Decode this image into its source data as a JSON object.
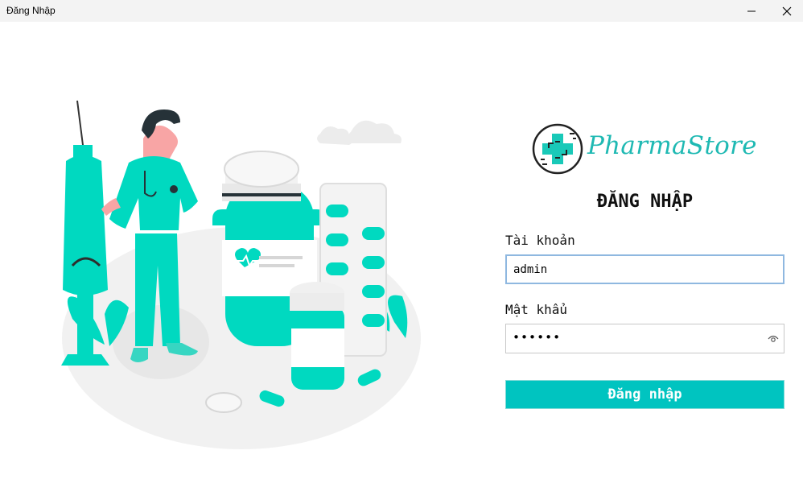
{
  "window": {
    "title": "Đăng Nhập",
    "controls": {
      "minimize_icon": "minimize-icon",
      "close_icon": "close-icon"
    }
  },
  "illustration": {
    "icon": "pharmacist-illustration"
  },
  "brand": {
    "logo_icon": "pharmacy-cross-logo-icon",
    "name": "PharmaStore",
    "color": "#1fb9b3"
  },
  "form": {
    "heading": "ĐĂNG NHẬP",
    "username_label": "Tài khoản",
    "username_value": "admin",
    "password_label": "Mật khẩu",
    "password_value": "••••••",
    "password_icon": "eye-icon",
    "submit_label": "Đăng nhập",
    "accent": "#00c4c0"
  }
}
